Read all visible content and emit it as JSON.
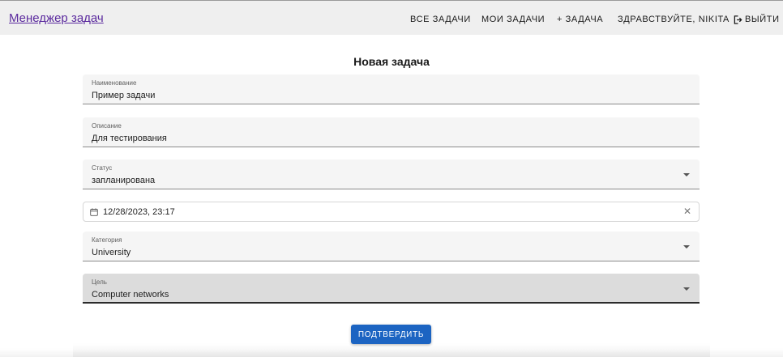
{
  "header": {
    "brand": "Менеджер задач",
    "nav": {
      "all_tasks": "ВСЕ ЗАДАЧИ",
      "my_tasks": "МОИ ЗАДАЧИ",
      "add_task": "+ ЗАДАЧА",
      "greeting": "ЗДРАВСТВУЙТЕ, NIKITA",
      "logout": "ВЫЙТИ"
    }
  },
  "form": {
    "title": "Новая задача",
    "name": {
      "label": "Наименование",
      "value": "Пример задачи"
    },
    "description": {
      "label": "Описание",
      "value": "Для тестирования"
    },
    "status": {
      "label": "Статус",
      "value": "запланирована"
    },
    "deadline": {
      "value": "12/28/2023, 23:17"
    },
    "category": {
      "label": "Категория",
      "value": "University"
    },
    "goal": {
      "label": "Цель",
      "value": "Computer networks"
    },
    "submit_label": "ПОДТВЕРДИТЬ"
  },
  "colors": {
    "accent": "#1c64c2",
    "brand_link": "#5b2a9e",
    "header_bg": "#efefef"
  },
  "icons": {
    "logout": "logout-icon",
    "calendar": "calendar-icon",
    "clear": "close-icon",
    "dropdown": "chevron-down-icon"
  }
}
